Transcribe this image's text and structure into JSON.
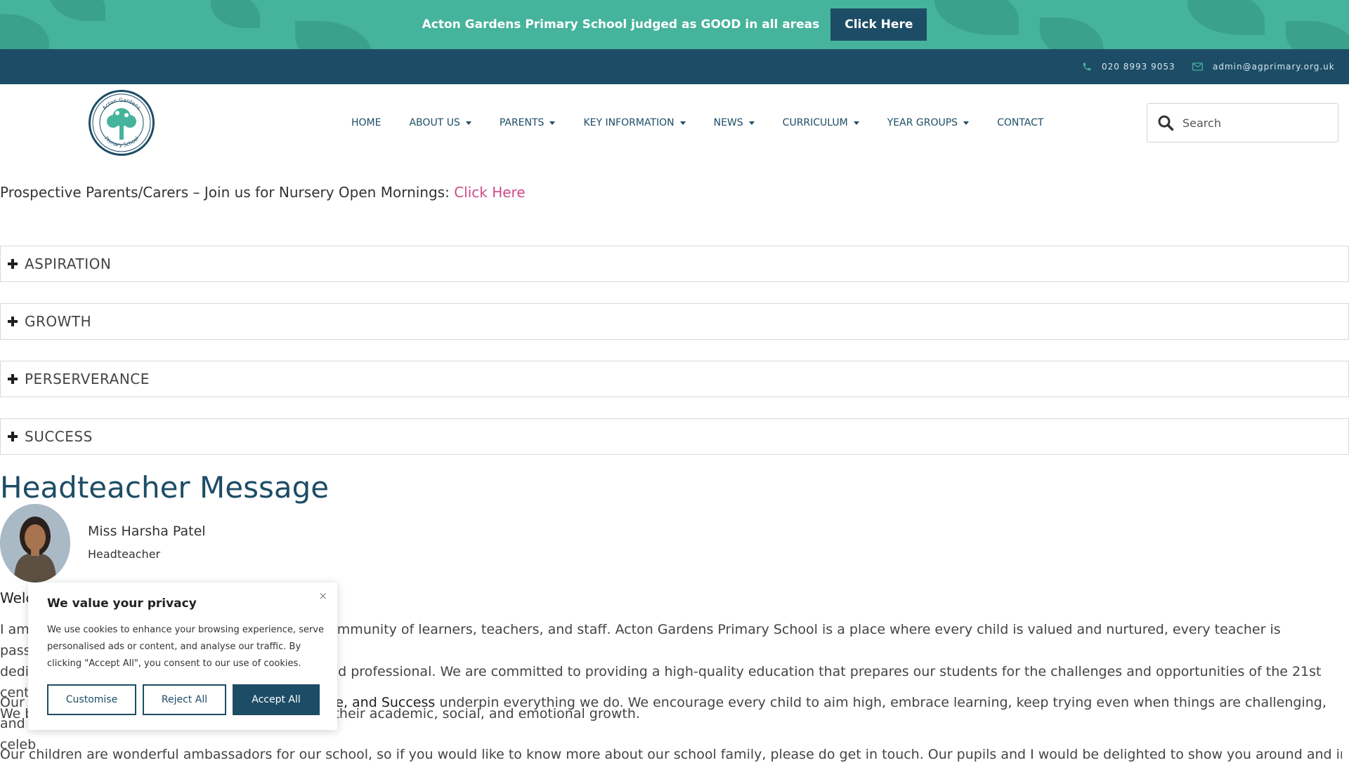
{
  "announcement": {
    "text": "Acton Gardens Primary School judged as GOOD in all areas",
    "button_label": "Click Here"
  },
  "contact": {
    "phone": "020 8993 9053",
    "email": "admin@agprimary.org.uk"
  },
  "logo": {
    "top_text": "Acton Gardens",
    "bottom_text": "Primary School"
  },
  "nav": {
    "items": [
      {
        "label": "HOME",
        "has_dropdown": false
      },
      {
        "label": "ABOUT US",
        "has_dropdown": true
      },
      {
        "label": "PARENTS",
        "has_dropdown": true
      },
      {
        "label": "KEY INFORMATION",
        "has_dropdown": true
      },
      {
        "label": "NEWS",
        "has_dropdown": true
      },
      {
        "label": "CURRICULUM",
        "has_dropdown": true
      },
      {
        "label": "YEAR GROUPS",
        "has_dropdown": true
      },
      {
        "label": "CONTACT",
        "has_dropdown": false
      }
    ]
  },
  "search": {
    "placeholder": "Search"
  },
  "promo": {
    "text": "Prospective Parents/Carers – Join us for Nursery Open Mornings:",
    "link": "Click Here"
  },
  "accordion": [
    {
      "title": "ASPIRATION"
    },
    {
      "title": "GROWTH"
    },
    {
      "title": "PERSERVERANCE"
    },
    {
      "title": "SUCCESS"
    }
  ],
  "headteacher": {
    "section_title": "Headteacher Message",
    "name": "Miss Harsha Patel",
    "role": "Headteacher",
    "welcome_visible": "Welc",
    "para1_start": "I am",
    "para1_rest": "mmunity of learners, teachers, and staff. Acton Gardens Primary School is a place where every child is valued and nurtured, every teacher is passionate and",
    "para1_line2_start": "dedi",
    "para1_line2_rest": "nd professional. We are committed to providing a high-quality education that prepares our students for the challenges and opportunities of the 21st century.",
    "para1_line3_start": "We b",
    "para1_line3_rest": "their academic, social, and emotional growth.",
    "para2_start": "Our",
    "para2_bold": "ce, and Success",
    "para2_rest": "underpin everything we do. We encourage every child to aim high, embrace learning, keep trying even when things are challenging, and",
    "para2_line2": "celeb",
    "para3": "Our children are wonderful ambassadors for our school, so if you would like to know more about our school family, please do get in touch. Our pupils and I would be delighted to show you around and introduce"
  },
  "cookie": {
    "close": "×",
    "title": "We value your privacy",
    "body": "We use cookies to enhance your browsing experience, serve personalised ads or content, and analyse our traffic. By clicking \"Accept All\", you consent to our use of cookies.",
    "customise": "Customise",
    "reject": "Reject All",
    "accept": "Accept All"
  },
  "colors": {
    "teal": "#46b39c",
    "navy": "#1d4d66",
    "pink_link": "#d24b86"
  }
}
